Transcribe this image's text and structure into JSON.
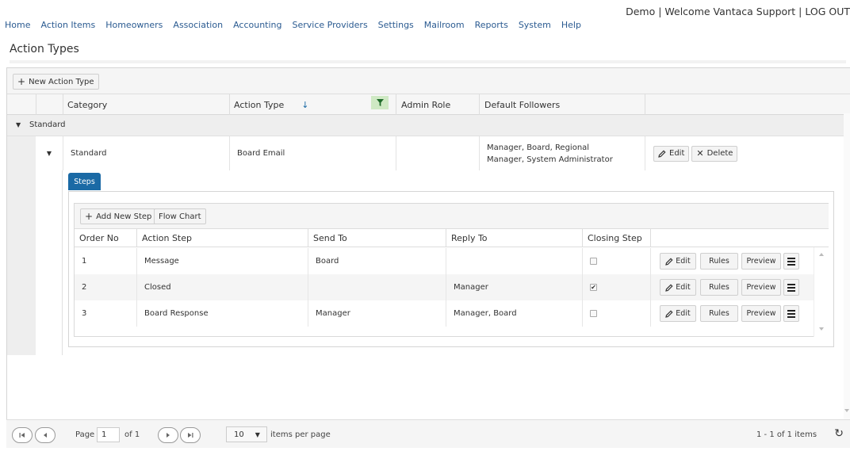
{
  "header": {
    "user_bar": "Demo | Welcome Vantaca Support |  LOG OUT"
  },
  "nav": {
    "items": [
      "Home",
      "Action Items",
      "Homeowners",
      "Association",
      "Accounting",
      "Service Providers",
      "Settings",
      "Mailroom",
      "Reports",
      "System",
      "Help"
    ]
  },
  "page": {
    "title": "Action Types"
  },
  "toolbar": {
    "new_action_type": "New Action Type"
  },
  "grid": {
    "columns": [
      "Category",
      "Action Type",
      "Admin Role",
      "Default Followers"
    ],
    "sort_indicator": "↓",
    "group_label": "Standard",
    "row": {
      "category": "Standard",
      "action_type": "Board Email",
      "admin_role": "",
      "default_followers": "Manager, Board, Regional Manager, System Administrator",
      "edit_label": "Edit",
      "delete_label": "Delete"
    }
  },
  "steps": {
    "tab_label": "Steps",
    "add_new_step": "Add New Step",
    "flow_chart": "Flow Chart",
    "columns": [
      "Order No",
      "Action Step",
      "Send To",
      "Reply To",
      "Closing Step"
    ],
    "rows": [
      {
        "order": "1",
        "step": "Message",
        "send_to": "Board",
        "reply_to": "",
        "closing": false
      },
      {
        "order": "2",
        "step": "Closed",
        "send_to": "",
        "reply_to": "Manager",
        "closing": true
      },
      {
        "order": "3",
        "step": "Board Response",
        "send_to": "Manager",
        "reply_to": "Manager, Board",
        "closing": false
      }
    ],
    "edit_label": "Edit",
    "rules_label": "Rules",
    "preview_label": "Preview"
  },
  "pager": {
    "page_label": "Page",
    "page_value": "1",
    "of_label": "of 1",
    "page_size": "10",
    "items_per_page": "items per page",
    "summary": "1 - 1 of 1 items"
  },
  "colors": {
    "nav_link": "#2b5b91",
    "tab_active": "#1b6aa5",
    "filter_active": "#cfe9c4"
  }
}
